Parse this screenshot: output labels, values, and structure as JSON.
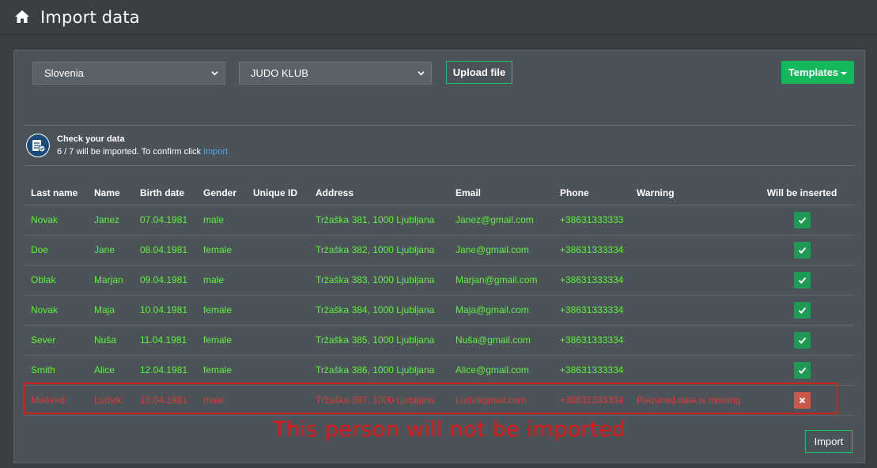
{
  "header": {
    "title": "Import data",
    "icon": "home-icon"
  },
  "toolbar": {
    "country": "Slovenia",
    "club": "JUDO KLUB",
    "upload_label": "Upload file",
    "templates_label": "Templates"
  },
  "info": {
    "title": "Check your data",
    "text": "6 / 7 will be imported. To confirm click ",
    "link": "Import",
    "icon": "data-check-icon"
  },
  "table": {
    "columns": [
      "Last name",
      "Name",
      "Birth date",
      "Gender",
      "Unique ID",
      "Address",
      "Email",
      "Phone",
      "Warning",
      "Will be inserted"
    ],
    "rows": [
      {
        "last": "Novak",
        "name": "Janez",
        "birth": "07.04.1981",
        "gender": "male",
        "uid": "",
        "address": "Tržaška 381, 1000 Ljubljana",
        "email": "Janez@gmail.com",
        "phone": "+38631333333",
        "warning": "",
        "insert": true
      },
      {
        "last": "Doe",
        "name": "Jane",
        "birth": "08.04.1981",
        "gender": "female",
        "uid": "",
        "address": "Tržaška 382, 1000 Ljubljana",
        "email": "Jane@gmail.com",
        "phone": "+38631333334",
        "warning": "",
        "insert": true
      },
      {
        "last": "Oblak",
        "name": "Marjan",
        "birth": "09.04.1981",
        "gender": "male",
        "uid": "",
        "address": "Tržaška 383, 1000 Ljubljana",
        "email": "Marjan@gmail.com",
        "phone": "+38631333334",
        "warning": "",
        "insert": true
      },
      {
        "last": "Novak",
        "name": "Maja",
        "birth": "10.04.1981",
        "gender": "female",
        "uid": "",
        "address": "Tržaška 384, 1000 Ljubljana",
        "email": "Maja@gmail.com",
        "phone": "+38631333334",
        "warning": "",
        "insert": true
      },
      {
        "last": "Sever",
        "name": "Nuša",
        "birth": "11.04.1981",
        "gender": "female",
        "uid": "",
        "address": "Tržaška 385, 1000 Ljubljana",
        "email": "Nuša@gmail.com",
        "phone": "+38631333334",
        "warning": "",
        "insert": true
      },
      {
        "last": "Smith",
        "name": "Alice",
        "birth": "12.04.1981",
        "gender": "female",
        "uid": "",
        "address": "Tržaška 386, 1000 Ljubljana",
        "email": "Alice@gmail.com",
        "phone": "+38631333334",
        "warning": "",
        "insert": true
      },
      {
        "last": "Medved",
        "name": "Ludvik",
        "birth": "13.04.1981",
        "gender": "male",
        "uid": "",
        "address": "Tržaška 387, 1000 Ljubljana",
        "email": "Ludvikgmail.com",
        "phone": "+38631333334",
        "warning": "Required data is missing",
        "insert": false
      }
    ]
  },
  "annotation": "This person will not be imported",
  "footer": {
    "import_label": "Import"
  },
  "colors": {
    "valid": "#5ef23d",
    "invalid": "#e03a3a",
    "accent": "#14b95c",
    "link": "#4aa8e0"
  }
}
